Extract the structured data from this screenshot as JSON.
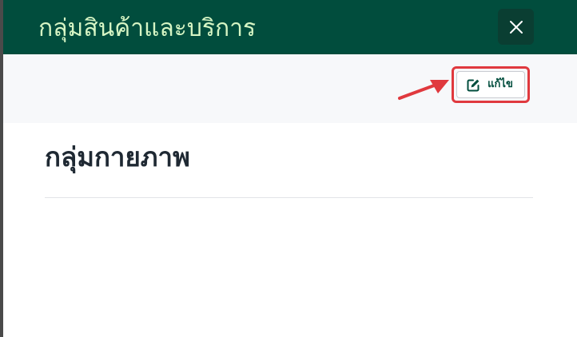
{
  "modal": {
    "title": "กลุ่มสินค้าและบริการ",
    "close_icon": "close-icon"
  },
  "toolbar": {
    "edit_label": "แก้ไข",
    "edit_icon": "edit-icon"
  },
  "content": {
    "group_name": "กลุ่มกายภาพ"
  },
  "colors": {
    "header_bg": "#014d3d",
    "header_text": "#d6f5c4",
    "accent": "#014d3d",
    "highlight": "#e0393e"
  }
}
